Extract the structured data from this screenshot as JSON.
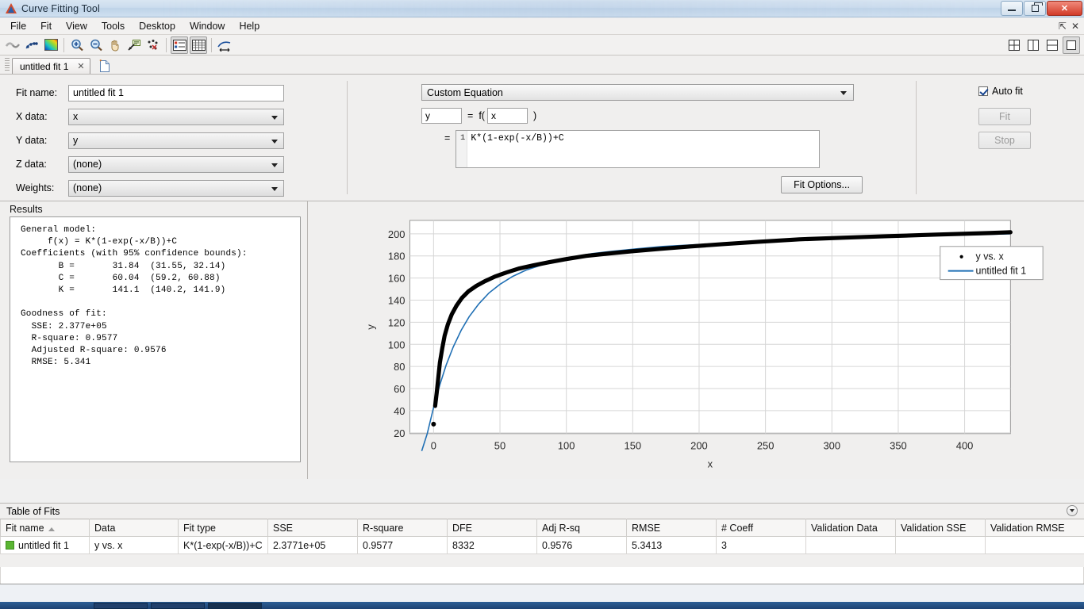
{
  "window": {
    "title": "Curve Fitting Tool",
    "icon": "matlab-logo-icon",
    "minimize": "minimize-button",
    "restore": "restore-button",
    "close": "✕"
  },
  "menubar": {
    "items": [
      "File",
      "Fit",
      "View",
      "Tools",
      "Desktop",
      "Window",
      "Help"
    ],
    "right": {
      "undock": "⇱",
      "close": "✕"
    }
  },
  "toolbar": {
    "buttons": [
      {
        "name": "fit-curve-icon",
        "title": "Fit"
      },
      {
        "name": "data-points-icon",
        "title": "Data"
      },
      {
        "name": "surface-colormap-icon",
        "title": "Surface"
      },
      {
        "name": "zoom-in-icon",
        "title": "Zoom In"
      },
      {
        "name": "zoom-out-icon",
        "title": "Zoom Out"
      },
      {
        "name": "pan-hand-icon",
        "title": "Pan"
      },
      {
        "name": "data-cursor-icon",
        "title": "Data Cursor"
      },
      {
        "name": "exclude-outliers-icon",
        "title": "Exclude Outliers"
      },
      {
        "name": "legend-toggle-icon",
        "title": "Legend"
      },
      {
        "name": "grid-toggle-icon",
        "title": "Grid"
      },
      {
        "name": "prediction-bounds-icon",
        "title": "Prediction Bounds"
      }
    ],
    "layout_buttons": [
      {
        "name": "layout-quad-icon",
        "selected": false
      },
      {
        "name": "layout-columns-icon",
        "selected": false
      },
      {
        "name": "layout-rows-icon",
        "selected": false
      },
      {
        "name": "layout-single-icon",
        "selected": true
      }
    ]
  },
  "tabs": {
    "fit_tab_label": "untitled fit 1",
    "fit_tab_close": "✕",
    "new_fit_icon": "new-fit-document-icon"
  },
  "fit_panel": {
    "fit_name_label": "Fit name:",
    "fit_name_value": "untitled fit 1",
    "x_data_label": "X data:",
    "x_data_value": "x",
    "y_data_label": "Y data:",
    "y_data_value": "y",
    "z_data_label": "Z data:",
    "z_data_value": "(none)",
    "weights_label": "Weights:",
    "weights_value": "(none)"
  },
  "equation_panel": {
    "fit_type": "Custom Equation",
    "output_var": "y",
    "equals": "=",
    "f_open": "f(",
    "input_var": "x",
    "f_close": ")",
    "equals2": "=",
    "line_number": "1",
    "expression": "K*(1-exp(-x/B))+C",
    "fit_options_label": "Fit Options..."
  },
  "run_panel": {
    "auto_fit_label": "Auto fit",
    "auto_fit_checked": true,
    "fit_label": "Fit",
    "stop_label": "Stop"
  },
  "results": {
    "title": "Results",
    "text": "General model:\n     f(x) = K*(1-exp(-x/B))+C\nCoefficients (with 95% confidence bounds):\n       B =       31.84  (31.55, 32.14)\n       C =       60.04  (59.2, 60.88)\n       K =       141.1  (140.2, 141.9)\n\nGoodness of fit:\n  SSE: 2.377e+05\n  R-square: 0.9577\n  Adjusted R-square: 0.9576\n  RMSE: 5.341"
  },
  "chart_data": {
    "type": "scatter",
    "title": "",
    "xlabel": "x",
    "ylabel": "y",
    "xlim": [
      -18,
      437
    ],
    "ylim": [
      17,
      212
    ],
    "xticks": [
      0,
      50,
      100,
      150,
      200,
      250,
      300,
      350,
      400
    ],
    "yticks": [
      20,
      40,
      60,
      80,
      100,
      120,
      140,
      160,
      180,
      200
    ],
    "grid": true,
    "legend_position": "right",
    "legend": [
      {
        "label": "y vs. x",
        "marker": "dot",
        "color": "#000000"
      },
      {
        "label": "untitled fit 1",
        "marker": "line",
        "color": "#1f6fb4"
      }
    ],
    "series": [
      {
        "name": "y vs. x",
        "type": "scatter",
        "color": "#000000",
        "points": [
          [
            1,
            28
          ],
          [
            2,
            45
          ],
          [
            3,
            62
          ],
          [
            4,
            80
          ],
          [
            5,
            95
          ],
          [
            6,
            108
          ],
          [
            8,
            126
          ],
          [
            10,
            139
          ],
          [
            13,
            151
          ],
          [
            16,
            159
          ],
          [
            20,
            166
          ],
          [
            25,
            172
          ],
          [
            30,
            176
          ],
          [
            35,
            179
          ],
          [
            40,
            182
          ],
          [
            50,
            186
          ],
          [
            60,
            189
          ],
          [
            70,
            191
          ],
          [
            80,
            192
          ],
          [
            90,
            193.5
          ],
          [
            100,
            194.5
          ],
          [
            120,
            196
          ],
          [
            140,
            197.5
          ],
          [
            160,
            198.5
          ],
          [
            180,
            199.5
          ],
          [
            200,
            200.5
          ],
          [
            230,
            201.5
          ],
          [
            260,
            202.5
          ],
          [
            290,
            203.5
          ],
          [
            320,
            204.5
          ],
          [
            350,
            205.5
          ],
          [
            380,
            206.3
          ],
          [
            405,
            207
          ]
        ]
      },
      {
        "name": "untitled fit 1",
        "type": "line",
        "color": "#1f6fb4",
        "equation": "y = 141.1*(1-exp(-x/31.84))+60.04",
        "coefficients": {
          "K": 141.1,
          "B": 31.84,
          "C": 60.04
        },
        "x_range": [
          -9,
          437
        ]
      }
    ]
  },
  "table_of_fits": {
    "title": "Table of Fits",
    "collapse_icon": "collapse-panel-icon",
    "columns": [
      "Fit name",
      "Data",
      "Fit type",
      "SSE",
      "R-square",
      "DFE",
      "Adj R-sq",
      "RMSE",
      "# Coeff",
      "Validation Data",
      "Validation SSE",
      "Validation RMSE"
    ],
    "sorted_column": "Fit name",
    "sort_direction": "ascending",
    "rows": [
      {
        "swatch_color": "#5ab532",
        "fit_name": "untitled fit 1",
        "data": "y vs. x",
        "fit_type": "K*(1-exp(-x/B))+C",
        "sse": "2.3771e+05",
        "r_square": "0.9577",
        "dfe": "8332",
        "adj_r_sq": "0.9576",
        "rmse": "5.3413",
        "num_coeff": "3",
        "validation_data": "",
        "validation_sse": "",
        "validation_rmse": ""
      }
    ]
  },
  "colors": {
    "fit_line": "#1f6fb4",
    "data_points": "#000000",
    "panel_bg": "#f0efee",
    "plot_bg": "#ffffff",
    "grid": "#d4d4d4"
  }
}
